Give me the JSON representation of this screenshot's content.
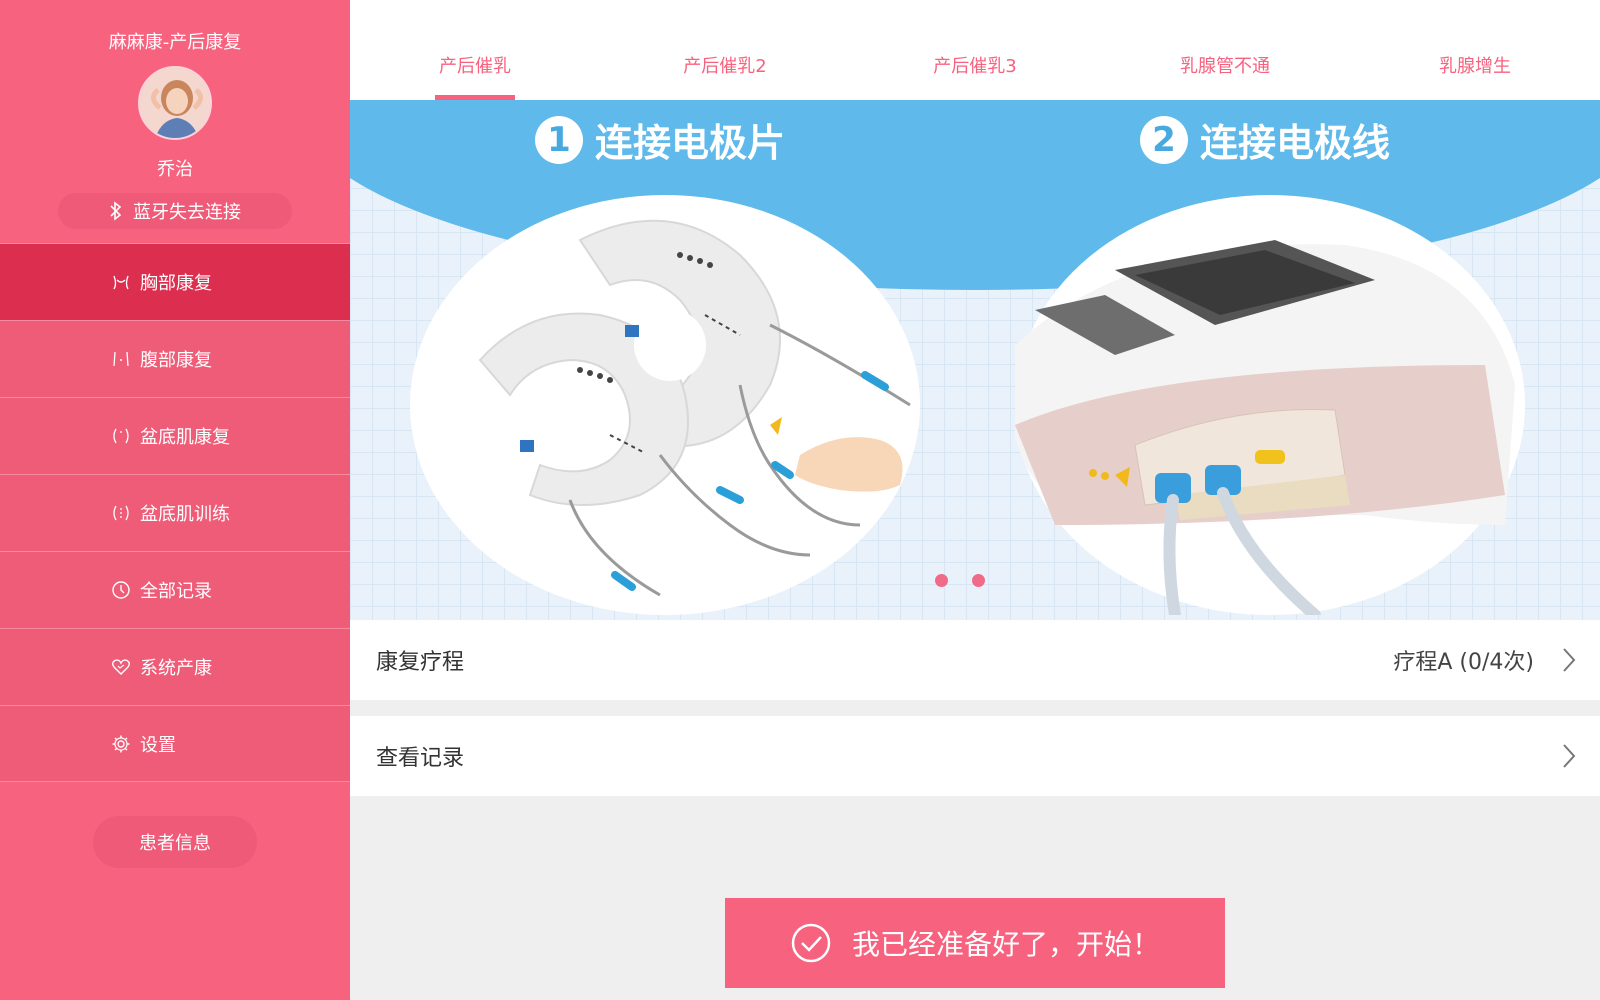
{
  "sidebar": {
    "app_title": "麻麻康-产后康复",
    "user_name": "乔治",
    "bluetooth_status": "蓝牙失去连接",
    "items": [
      {
        "label": "胸部康复",
        "icon": "chest-icon"
      },
      {
        "label": "腹部康复",
        "icon": "abdomen-icon"
      },
      {
        "label": "盆底肌康复",
        "icon": "pelvic-icon"
      },
      {
        "label": "盆底肌训练",
        "icon": "pelvic-training-icon"
      },
      {
        "label": "全部记录",
        "icon": "clock-icon"
      },
      {
        "label": "系统产康",
        "icon": "heart-icon"
      },
      {
        "label": "设置",
        "icon": "gear-icon"
      }
    ],
    "patient_button": "患者信息"
  },
  "tabs": [
    {
      "label": "产后催乳"
    },
    {
      "label": "产后催乳2"
    },
    {
      "label": "产后催乳3"
    },
    {
      "label": "乳腺管不通"
    },
    {
      "label": "乳腺增生"
    }
  ],
  "banner": {
    "step1_num": "1",
    "step1_text": "连接电极片",
    "step2_num": "2",
    "step2_text": "连接电极线"
  },
  "course_row": {
    "label": "康复疗程",
    "value": "疗程A (0/4次)"
  },
  "records_row": {
    "label": "查看记录"
  },
  "start_button": "我已经准备好了，开始！",
  "colors": {
    "primary": "#f7627f",
    "active": "#dc2e4e"
  }
}
